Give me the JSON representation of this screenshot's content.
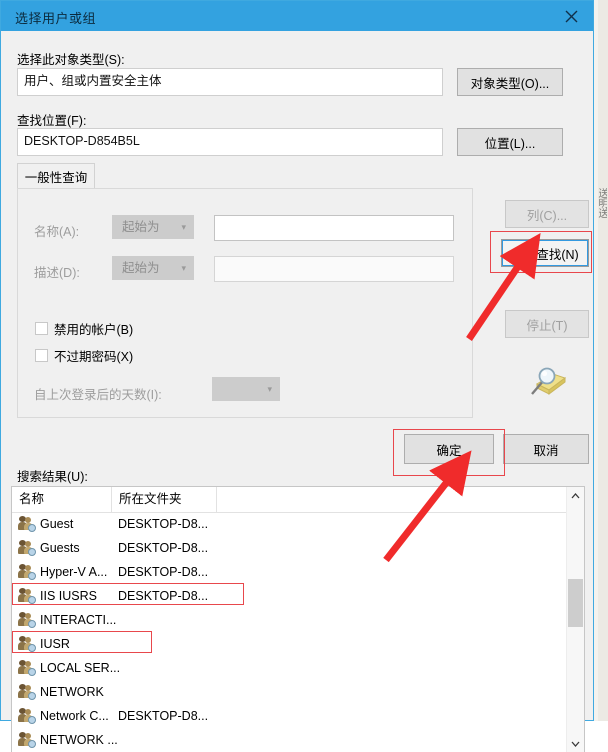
{
  "window": {
    "title": "选择用户或组",
    "close_icon": "close-icon",
    "titlebar_color": "#33a2e0"
  },
  "object_type": {
    "label": "选择此对象类型(S):",
    "value": "用户、组或内置安全主体",
    "button": "对象类型(O)..."
  },
  "location": {
    "label": "查找位置(F):",
    "value": "DESKTOP-D854B5L",
    "button": "位置(L)..."
  },
  "tabs": [
    {
      "label": "一般性查询",
      "selected": true
    }
  ],
  "query": {
    "name": {
      "label": "名称(A):",
      "condition": "起始为",
      "value": "",
      "placeholder": ""
    },
    "description": {
      "label": "描述(D):",
      "condition": "起始为",
      "value": "",
      "placeholder": ""
    },
    "disabled_accounts": {
      "label": "禁用的帐户(B)",
      "checked": false
    },
    "non_expiring_password": {
      "label": "不过期密码(X)",
      "checked": false
    },
    "days_since_login": {
      "label": "自上次登录后的天数(I):",
      "value": ""
    }
  },
  "side_buttons": {
    "columns": {
      "label": "列(C)...",
      "enabled": false
    },
    "find_now": {
      "label": "立即查找(N)",
      "enabled": true,
      "focused": true
    },
    "stop": {
      "label": "停止(T)",
      "enabled": false
    },
    "search_icon": "magnifier-folder-icon"
  },
  "footer": {
    "ok": "确定",
    "cancel": "取消"
  },
  "results": {
    "label": "搜索结果(U):",
    "columns": [
      "名称",
      "所在文件夹"
    ],
    "rows": [
      {
        "icon": "user-icon",
        "name": "Guest",
        "folder": "DESKTOP-D8..."
      },
      {
        "icon": "group-icon",
        "name": "Guests",
        "folder": "DESKTOP-D8..."
      },
      {
        "icon": "group-icon",
        "name": "Hyper-V A...",
        "folder": "DESKTOP-D8..."
      },
      {
        "icon": "group-icon",
        "name": "IIS IUSRS",
        "folder": "DESKTOP-D8...",
        "highlighted": true
      },
      {
        "icon": "group-icon",
        "name": "INTERACTI...",
        "folder": ""
      },
      {
        "icon": "group-icon",
        "name": "IUSR",
        "folder": "",
        "highlighted": true
      },
      {
        "icon": "group-icon",
        "name": "LOCAL SER...",
        "folder": ""
      },
      {
        "icon": "group-icon",
        "name": "NETWORK",
        "folder": ""
      },
      {
        "icon": "group-icon",
        "name": "Network C...",
        "folder": "DESKTOP-D8..."
      },
      {
        "icon": "group-icon",
        "name": "NETWORK ...",
        "folder": ""
      }
    ],
    "scrollbar": {
      "up_icon": "chevron-up-icon",
      "down_icon": "chevron-down-icon"
    }
  },
  "annotations": {
    "marker_color": "#e8474c",
    "boxes": [
      "find-now-button",
      "ok-button",
      "row-iis-iusrs",
      "row-iusr"
    ],
    "arrows": [
      "arrow-to-find-now",
      "arrow-to-ok"
    ]
  }
}
